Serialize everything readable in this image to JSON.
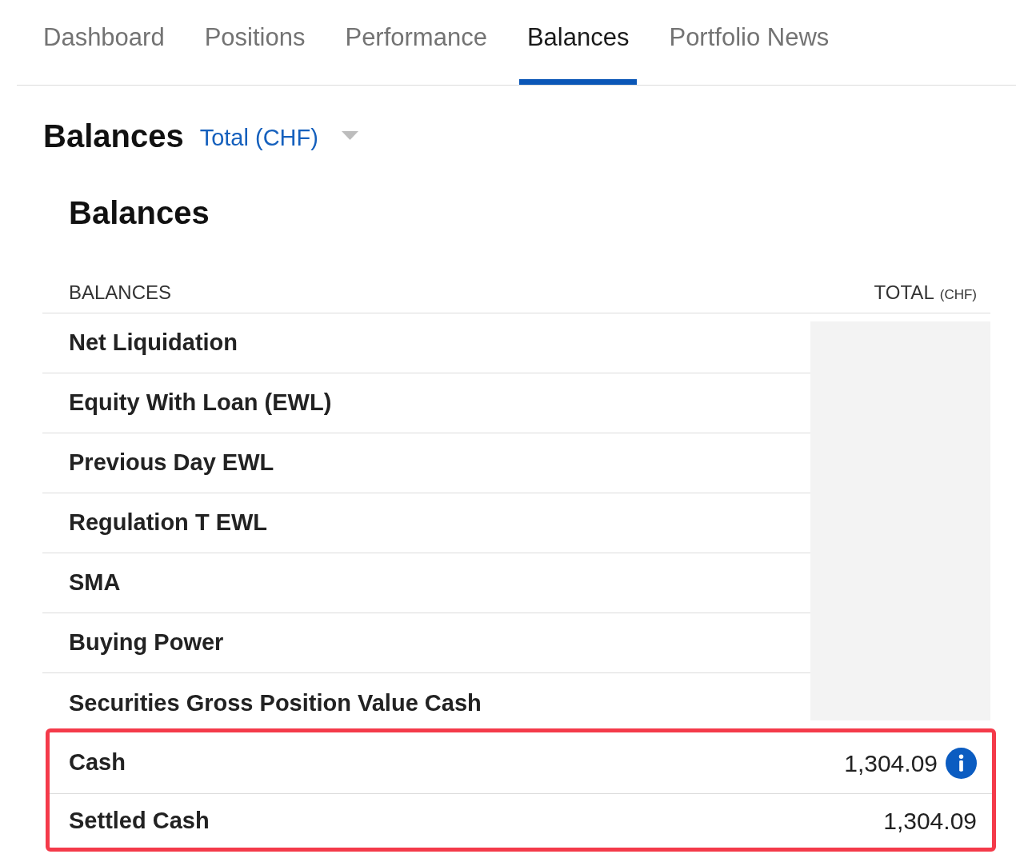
{
  "tabs": [
    {
      "label": "Dashboard",
      "selected": false
    },
    {
      "label": "Positions",
      "selected": false
    },
    {
      "label": "Performance",
      "selected": false
    },
    {
      "label": "Balances",
      "selected": true
    },
    {
      "label": "Portfolio News",
      "selected": false
    }
  ],
  "header": {
    "title": "Balances",
    "account_selector": "Total (CHF)"
  },
  "section": {
    "title": "Balances"
  },
  "table": {
    "columns": [
      {
        "label": "BALANCES"
      },
      {
        "label": "TOTAL",
        "unit": "(CHF)"
      }
    ],
    "rows": [
      {
        "label": "Net Liquidation",
        "blurred": true
      },
      {
        "label": "Equity With Loan (EWL)",
        "blurred": true
      },
      {
        "label": "Previous Day EWL",
        "blurred": true
      },
      {
        "label": "Regulation T EWL",
        "blurred": true
      },
      {
        "label": "SMA",
        "blurred": true
      },
      {
        "label": "Buying Power",
        "blurred": true
      },
      {
        "label": "Securities Gross Position Value Cash",
        "blurred": true
      }
    ],
    "highlighted_rows": [
      {
        "label": "Cash",
        "value": "1,304.09",
        "info": true
      },
      {
        "label": "Settled Cash",
        "value": "1,304.09"
      }
    ]
  }
}
